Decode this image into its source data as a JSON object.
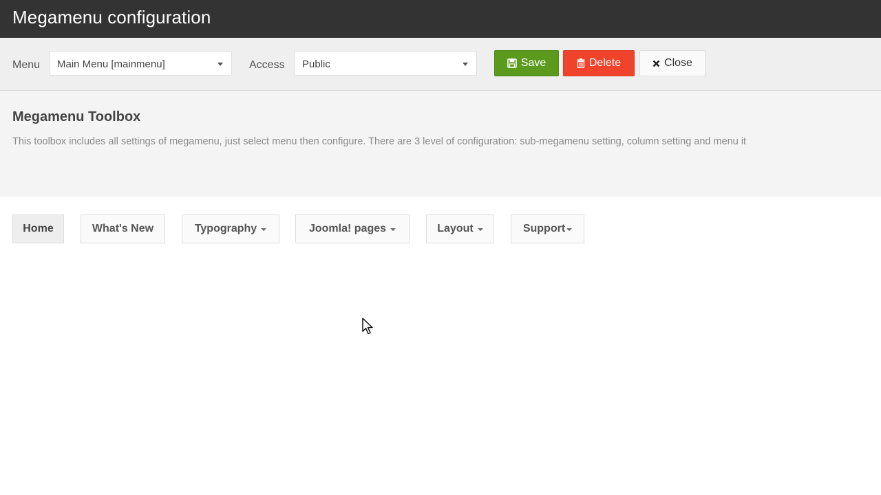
{
  "header": {
    "title": "Megamenu configuration"
  },
  "toolbar": {
    "menu_label": "Menu",
    "menu_value": "Main Menu [mainmenu]",
    "access_label": "Access",
    "access_value": "Public",
    "save_label": "Save",
    "delete_label": "Delete",
    "close_label": "Close"
  },
  "toolbox": {
    "heading": "Megamenu Toolbox",
    "description": "This toolbox includes all settings of megamenu, just select menu then configure. There are 3 level of configuration: sub-megamenu setting, column setting and menu it"
  },
  "nav": {
    "items": [
      {
        "label": "Home",
        "has_dropdown": false,
        "active": true
      },
      {
        "label": "What's New",
        "has_dropdown": false,
        "active": false
      },
      {
        "label": "Typography",
        "has_dropdown": true,
        "active": false
      },
      {
        "label": "Joomla! pages",
        "has_dropdown": true,
        "active": false
      },
      {
        "label": "Layout",
        "has_dropdown": true,
        "active": false
      },
      {
        "label": "Support",
        "has_dropdown": true,
        "active": false
      }
    ]
  },
  "colors": {
    "titlebar": "#333333",
    "save": "#5c9a1e",
    "delete": "#f0432c"
  },
  "icons": [
    "save-icon",
    "trash-icon",
    "close-icon",
    "caret-down-icon",
    "mouse-cursor-icon"
  ]
}
